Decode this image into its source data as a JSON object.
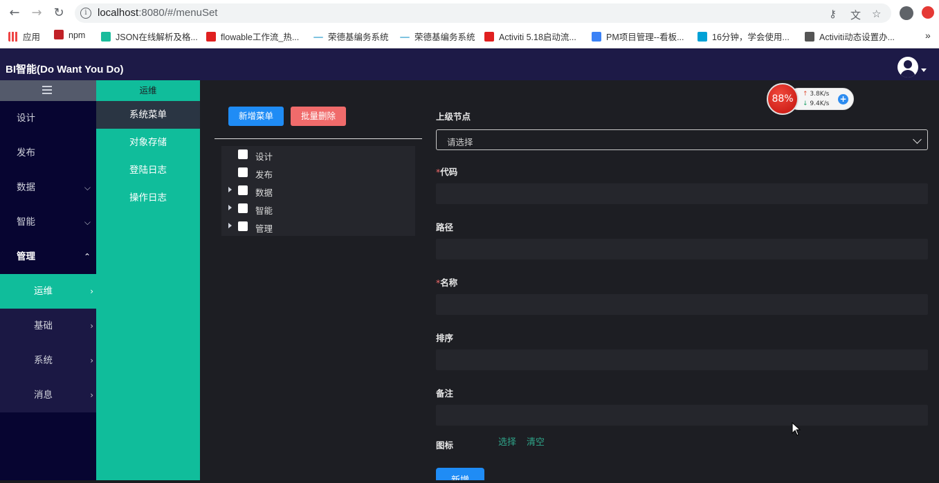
{
  "browser": {
    "url_host": "localhost",
    "url_rest": ":8080/#/menuSet",
    "bookmarks": [
      {
        "label": "应用",
        "color": "#e44"
      },
      {
        "label": "npm",
        "color": "#c12127"
      },
      {
        "label": "JSON在线解析及格...",
        "color": "#1abc9c"
      },
      {
        "label": "flowable工作流_热...",
        "color": "#e02020"
      },
      {
        "label": "荣德基编务系统",
        "color": "#7fc3e0"
      },
      {
        "label": "荣德基编务系统",
        "color": "#7fc3e0"
      },
      {
        "label": "Activiti 5.18启动流...",
        "color": "#e02020"
      },
      {
        "label": "PM项目管理--看板...",
        "color": "#3b82f6"
      },
      {
        "label": "16分钟，学会使用...",
        "color": "#00a1d6"
      },
      {
        "label": "Activiti动态设置办...",
        "color": "#555"
      }
    ],
    "more_bookmarks": "»"
  },
  "header": {
    "title": "BI智能(Do Want You Do)"
  },
  "leftmenu": {
    "items": [
      {
        "label": "设计",
        "chev": ""
      },
      {
        "label": "发布",
        "chev": ""
      },
      {
        "label": "数据",
        "chev": "⌵"
      },
      {
        "label": "智能",
        "chev": "⌵"
      },
      {
        "label": "管理",
        "chev": "⌃"
      }
    ],
    "subitems": [
      {
        "label": "运维",
        "chev": "›"
      },
      {
        "label": "基础",
        "chev": "›"
      },
      {
        "label": "系统",
        "chev": "›"
      },
      {
        "label": "消息",
        "chev": "›"
      }
    ]
  },
  "secondmenu": {
    "title": "运维",
    "items": [
      "系统菜单",
      "对象存储",
      "登陆日志",
      "操作日志"
    ]
  },
  "toolbar": {
    "add_label": "新增菜单",
    "batch_delete_label": "批量删除"
  },
  "tree": {
    "nodes": [
      {
        "label": "设计",
        "expandable": false
      },
      {
        "label": "发布",
        "expandable": false
      },
      {
        "label": "数据",
        "expandable": true
      },
      {
        "label": "智能",
        "expandable": true
      },
      {
        "label": "管理",
        "expandable": true
      }
    ]
  },
  "form": {
    "parent_label": "上级节点",
    "parent_placeholder": "请选择",
    "required_mark": "*",
    "code_label": "代码",
    "path_label": "路径",
    "name_label": "名称",
    "sort_label": "排序",
    "remark_label": "备注",
    "icon_label": "图标",
    "icon_select": "选择",
    "icon_clear": "清空",
    "submit_label": "新增"
  },
  "widget": {
    "percent": "88%",
    "up_speed": "3.8K/s",
    "down_speed": "9.4K/s"
  },
  "colors": {
    "accent": "#10bd9b",
    "header": "#1d1a47",
    "primary": "#1f8cf5",
    "danger": "#f06b6b"
  }
}
